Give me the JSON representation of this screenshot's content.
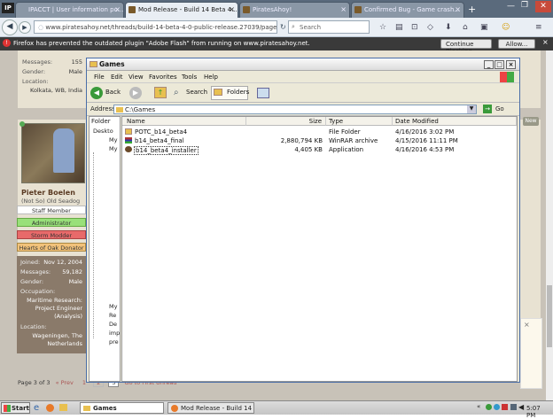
{
  "browser": {
    "tabs": [
      {
        "label": "IPACCT | User information po...",
        "active": false
      },
      {
        "label": "Mod Release - Build 14 Beta 4...",
        "active": true
      },
      {
        "label": "PiratesAhoy!",
        "active": false
      },
      {
        "label": "Confirmed Bug - Game crash...",
        "active": false
      }
    ],
    "url": "www.piratesahoy.net/threads/build-14-beta-4-0-public-release.27039/page-",
    "search_placeholder": "Search",
    "flash_message": "Firefox has prevented the outdated plugin \"Adobe Flash\" from running on www.piratesahoy.net.",
    "continue_blocking": "Continue Blocking",
    "allow": "Allow..."
  },
  "forum": {
    "top_user": {
      "messages_label": "Messages:",
      "messages": "155",
      "gender_label": "Gender:",
      "gender": "Male",
      "location_label": "Location:",
      "location": "Kolkata, WB, India"
    },
    "user": {
      "name": "Pieter Boelen",
      "title": "(Not So) Old Seadog",
      "badges": [
        "Staff Member",
        "Administrator",
        "Storm Modder",
        "Hearts of Oak Donator"
      ],
      "joined_label": "Joined:",
      "joined": "Nov 12, 2004",
      "messages_label": "Messages:",
      "messages": "59,182",
      "gender_label": "Gender:",
      "gender": "Male",
      "occupation_label": "Occupation:",
      "occupation": "Maritime Research: Project Engineer (Analysis)",
      "location_label": "Location:",
      "location": "Wageningen, The Netherlands"
    },
    "pager": {
      "label": "Page 3 of 3",
      "prev": "« Prev",
      "pages": [
        "1",
        "2",
        "3"
      ],
      "first_unread": "Go to First Unread"
    },
    "new_badge": "New"
  },
  "explorer": {
    "title": "Games",
    "menu": [
      "File",
      "Edit",
      "View",
      "Favorites",
      "Tools",
      "Help"
    ],
    "toolbar": {
      "back": "Back",
      "search": "Search",
      "folders": "Folders"
    },
    "address_label": "Address",
    "address": "C:\\Games",
    "go": "Go",
    "folder_header": "Folder",
    "tree_items": [
      "Deskto",
      "My",
      "My",
      "My",
      "Re",
      "De",
      "imp",
      "pre"
    ],
    "columns": [
      "Name",
      "Size",
      "Type",
      "Date Modified"
    ],
    "files": [
      {
        "name": "POTC_b14_beta4",
        "size": "",
        "type": "File Folder",
        "date": "4/16/2016 3:02 PM",
        "icon": "folder-icon"
      },
      {
        "name": "b14_beta4_final",
        "size": "2,880,794 KB",
        "type": "WinRAR archive",
        "date": "4/15/2016 11:11 PM",
        "icon": "winrar-icon"
      },
      {
        "name": "b14_beta4_installer",
        "size": "4,405 KB",
        "type": "Application",
        "date": "4/16/2016 4:53 PM",
        "icon": "installer-icon"
      }
    ]
  },
  "taskbar": {
    "start": "Start",
    "tasks": [
      {
        "label": "Games",
        "active": true
      },
      {
        "label": "Mod Release - Build 14 B...",
        "active": false
      }
    ],
    "clock": "5:07 PM"
  },
  "colors": {
    "staff": "#ffffff",
    "admin": "#99e07a",
    "storm": "#e86a6a",
    "donator": "#f2c27a"
  }
}
